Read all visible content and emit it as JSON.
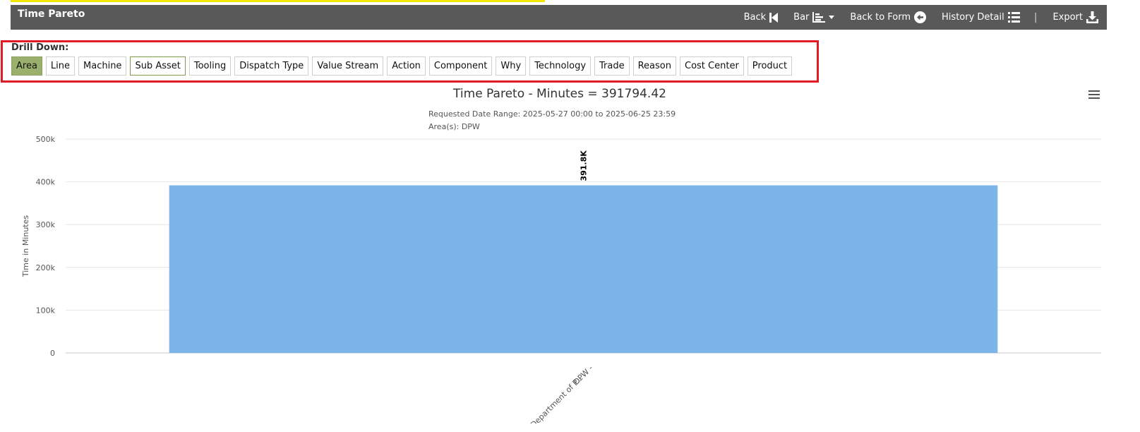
{
  "header": {
    "title": "Time Pareto",
    "actions": {
      "back": "Back",
      "bar": "Bar",
      "back_to_form": "Back to Form",
      "history_detail": "History Detail",
      "separator": "|",
      "export": "Export"
    }
  },
  "drill_down": {
    "label": "Drill Down:",
    "buttons": [
      "Area",
      "Line",
      "Machine",
      "Sub Asset",
      "Tooling",
      "Dispatch Type",
      "Value Stream",
      "Action",
      "Component",
      "Why",
      "Technology",
      "Trade",
      "Reason",
      "Cost Center",
      "Product"
    ],
    "active": "Area",
    "highlighted": "Sub Asset"
  },
  "colors": {
    "header_bg": "#595959",
    "active_button": "#9bb06c",
    "bar": "#7cb4ea",
    "highlight_border": "#e01b22"
  },
  "chart_data": {
    "type": "bar",
    "title": "Time Pareto - Minutes = 391794.42",
    "subtitle_lines": [
      "Requested Date Range: 2025-05-27 00:00 to 2025-06-25 23:59",
      "Area(s): DPW"
    ],
    "ylabel": "Time in Minutes",
    "xlabel": "",
    "ylim": [
      0,
      500000
    ],
    "yticks": [
      0,
      100000,
      200000,
      300000,
      400000,
      500000
    ],
    "ytick_labels": [
      "0",
      "100k",
      "200k",
      "300k",
      "400k",
      "500k"
    ],
    "categories": [
      [
        "DPW -",
        "Department of P..."
      ]
    ],
    "values": [
      391794.42
    ],
    "data_labels": [
      "391.8K"
    ],
    "grid": true,
    "legend": "none"
  }
}
